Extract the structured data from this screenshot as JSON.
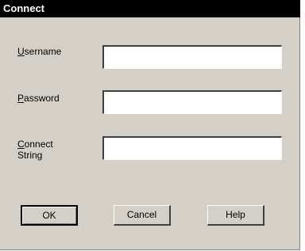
{
  "window": {
    "title": "Connect"
  },
  "fields": {
    "username": {
      "label_mnemonic": "U",
      "label_rest": "sername",
      "value": ""
    },
    "password": {
      "label_mnemonic": "P",
      "label_rest": "assword",
      "value": ""
    },
    "connect_string": {
      "label_mnemonic": "C",
      "label_line1_rest": "onnect",
      "label_line2": "String",
      "value": ""
    }
  },
  "buttons": {
    "ok": "OK",
    "cancel": "Cancel",
    "help": "Help"
  }
}
